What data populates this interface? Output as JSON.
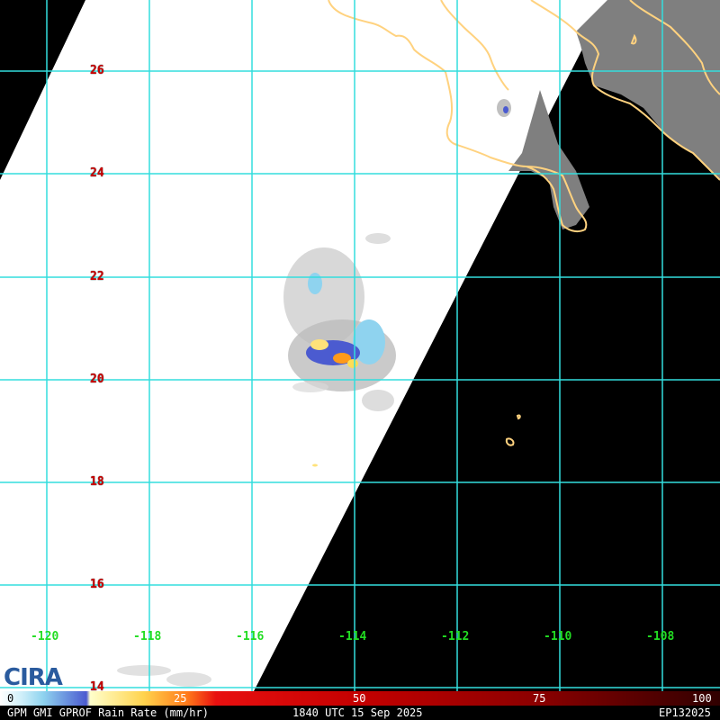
{
  "title": "GPM GMI GPROF Rain Rate (mm/hr)",
  "timestamp": "1840 UTC 15 Sep 2025",
  "storm_id": "EP132025",
  "logo_text": "CIRA",
  "colorbar": {
    "ticks": [
      "0",
      "25",
      "50",
      "75",
      "100"
    ],
    "unit": "mm/hr"
  },
  "grid": {
    "lat_labels": [
      "26",
      "24",
      "22",
      "20",
      "18",
      "16",
      "14"
    ],
    "lon_labels": [
      "-120",
      "-118",
      "-116",
      "-114",
      "-112",
      "-110",
      "-108"
    ]
  },
  "colors": {
    "grid": "#33dddd",
    "coastline": "#ffd27f",
    "land": "#808080",
    "swath": "#ffffff",
    "background": "#000000",
    "lat_label": "#cc0000",
    "lon_label": "#22dd22"
  }
}
